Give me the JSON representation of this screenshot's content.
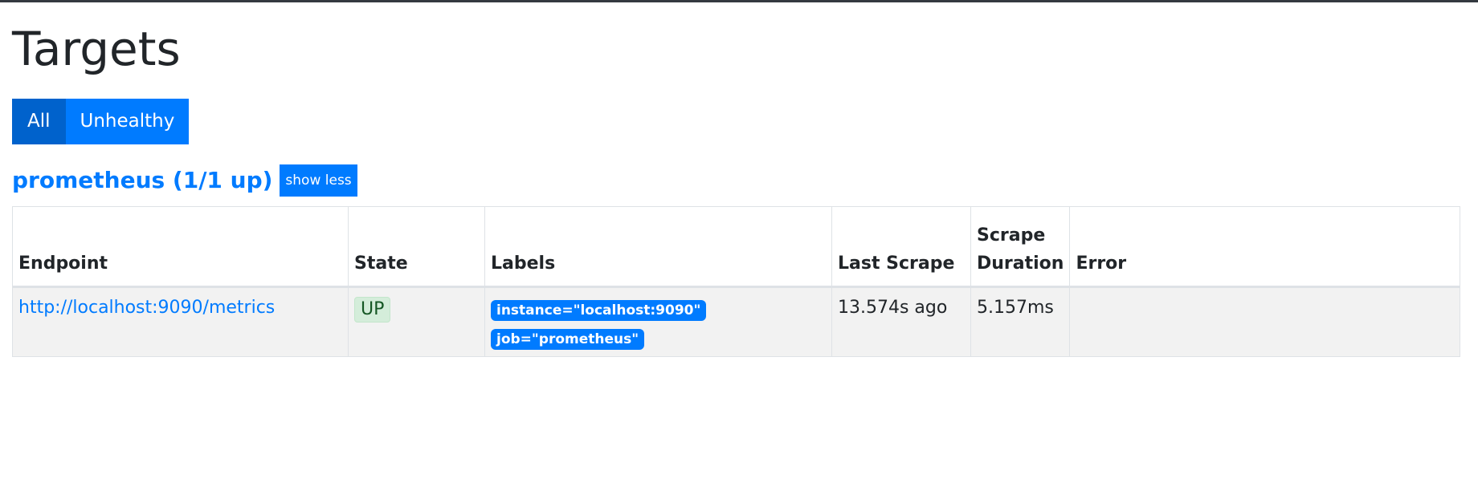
{
  "page": {
    "title": "Targets"
  },
  "filters": {
    "all_label": "All",
    "unhealthy_label": "Unhealthy"
  },
  "job": {
    "header": "prometheus (1/1 up)",
    "toggle_label": "show less"
  },
  "table": {
    "headers": {
      "endpoint": "Endpoint",
      "state": "State",
      "labels": "Labels",
      "last_scrape": "Last Scrape",
      "scrape_duration_line1": "Scrape",
      "scrape_duration_line2": "Duration",
      "error": "Error"
    },
    "rows": [
      {
        "endpoint": "http://localhost:9090/metrics",
        "state": "UP",
        "labels": [
          "instance=\"localhost:9090\"",
          "job=\"prometheus\""
        ],
        "last_scrape": "13.574s ago",
        "scrape_duration": "5.157ms",
        "error": ""
      }
    ]
  },
  "colors": {
    "primary": "#007bff",
    "primary_active": "#0062cc",
    "success_bg": "#d4edda",
    "success_text": "#155724",
    "topbar": "#343a40"
  }
}
